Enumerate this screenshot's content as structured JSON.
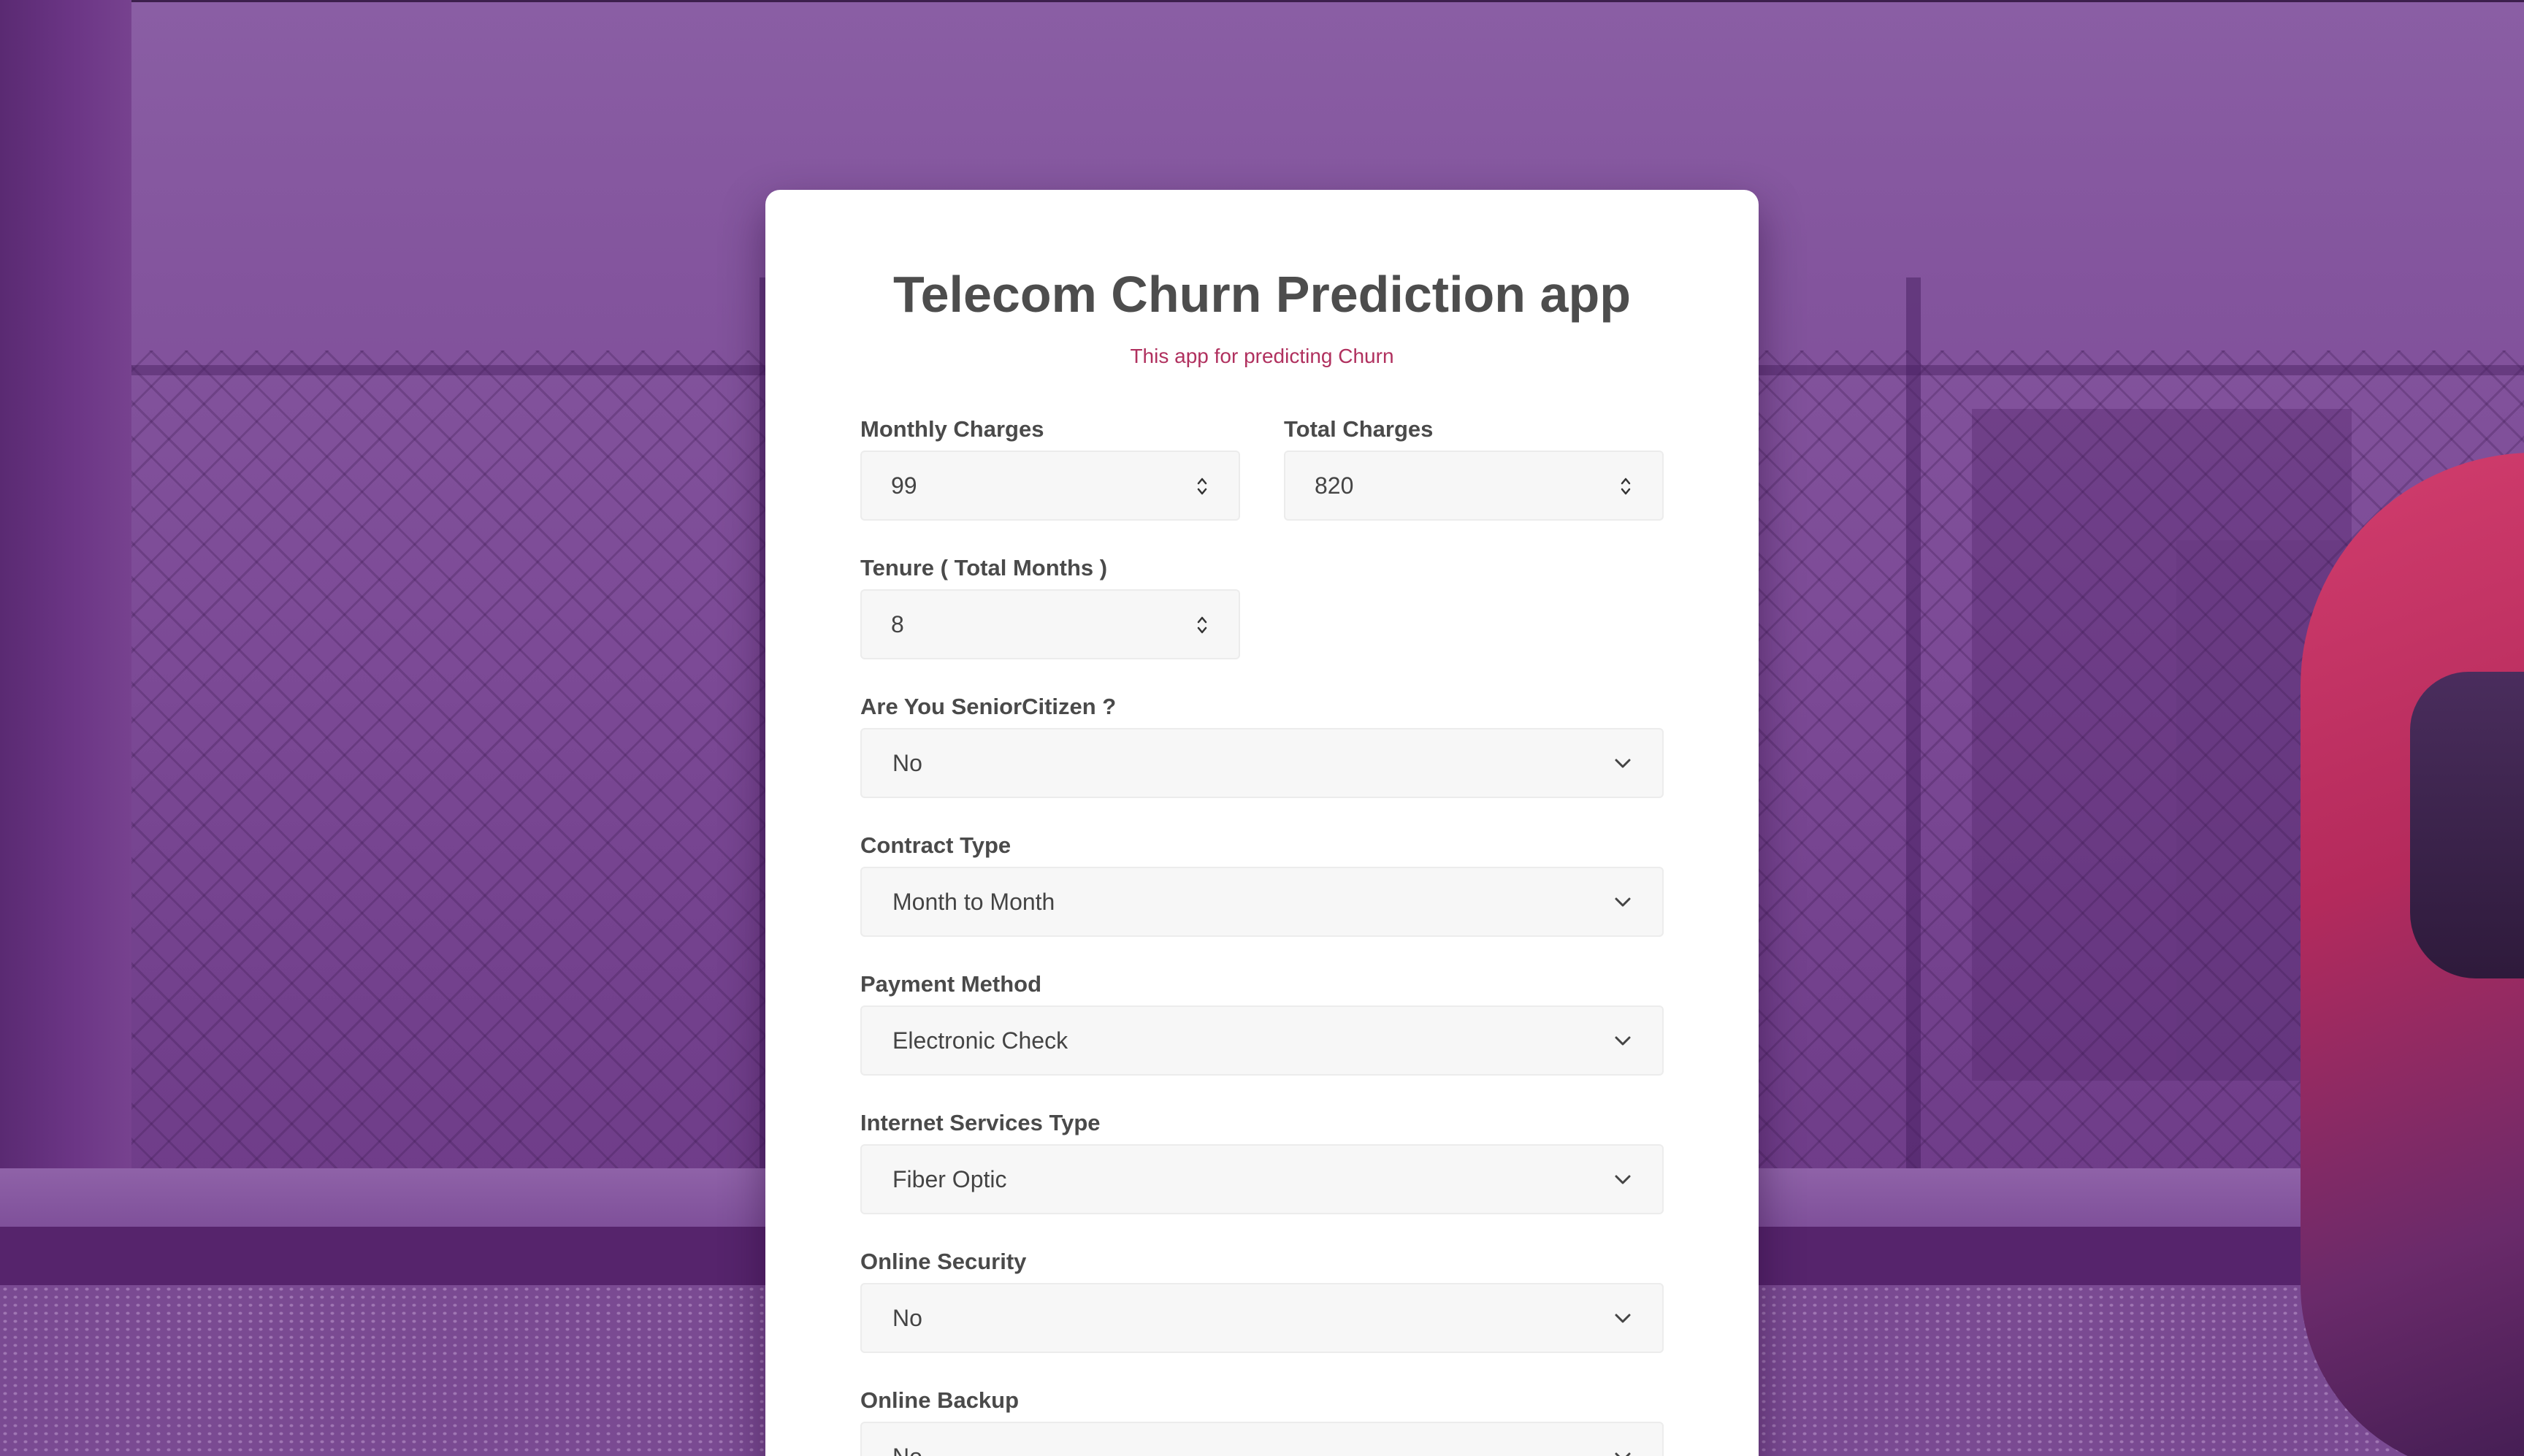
{
  "app": {
    "title": "Telecom Churn Prediction app",
    "subtitle": "This app for predicting Churn"
  },
  "form": {
    "monthly_charges": {
      "label": "Monthly Charges",
      "value": "99",
      "icon": "spinner-icon"
    },
    "total_charges": {
      "label": "Total Charges",
      "value": "820",
      "icon": "spinner-icon"
    },
    "tenure": {
      "label": "Tenure ( Total Months )",
      "value": "8",
      "icon": "spinner-icon"
    },
    "senior_citizen": {
      "label": "Are You SeniorCitizen ?",
      "value": "No",
      "icon": "chevron-down-icon"
    },
    "contract_type": {
      "label": "Contract Type",
      "value": "Month to Month",
      "icon": "chevron-down-icon"
    },
    "payment_method": {
      "label": "Payment Method",
      "value": "Electronic Check",
      "icon": "chevron-down-icon"
    },
    "internet_service": {
      "label": "Internet Services Type",
      "value": "Fiber Optic",
      "icon": "chevron-down-icon"
    },
    "online_security": {
      "label": "Online Security",
      "value": "No",
      "icon": "chevron-down-icon"
    },
    "online_backup": {
      "label": "Online Backup",
      "value": "No",
      "icon": "chevron-down-icon"
    }
  },
  "colors": {
    "background_tint": "#7a4492",
    "title": "#4d4d4d",
    "subtitle": "#b0305e",
    "field_bg": "#f7f7f7"
  }
}
